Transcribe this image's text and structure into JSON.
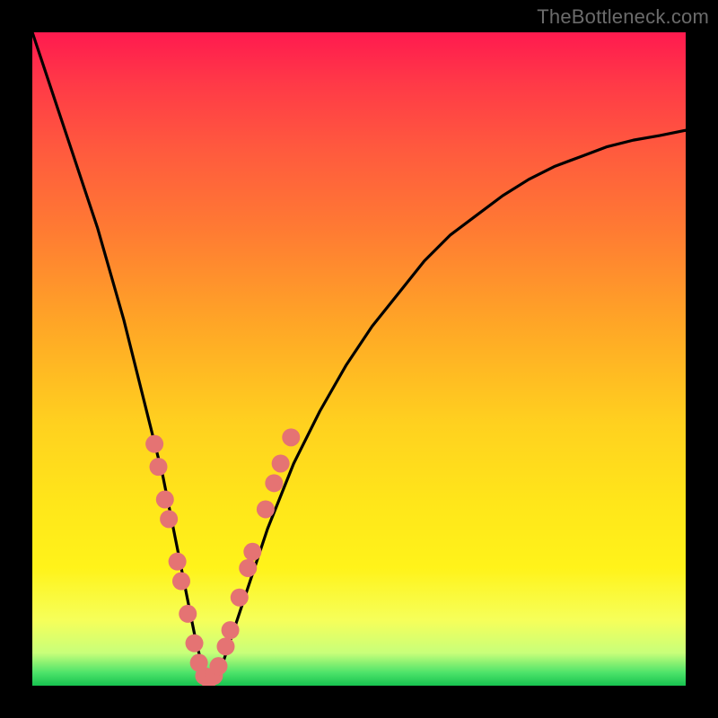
{
  "watermark": {
    "text": "TheBottleneck.com"
  },
  "chart_data": {
    "type": "line",
    "title": "",
    "xlabel": "",
    "ylabel": "",
    "xlim": [
      0,
      100
    ],
    "ylim": [
      0,
      100
    ],
    "series": [
      {
        "name": "bottleneck-curve",
        "x": [
          0,
          2,
          4,
          6,
          8,
          10,
          12,
          14,
          16,
          18,
          20,
          22,
          23,
          24,
          25,
          26,
          27,
          28,
          29,
          30,
          32,
          34,
          36,
          38,
          40,
          44,
          48,
          52,
          56,
          60,
          64,
          68,
          72,
          76,
          80,
          84,
          88,
          92,
          96,
          100
        ],
        "y": [
          100,
          94,
          88,
          82,
          76,
          70,
          63,
          56,
          48,
          40,
          32,
          22,
          17,
          12,
          7,
          3,
          1,
          1,
          3,
          6,
          12,
          18,
          24,
          29,
          34,
          42,
          49,
          55,
          60,
          65,
          69,
          72,
          75,
          77.5,
          79.5,
          81,
          82.5,
          83.5,
          84.2,
          85
        ]
      }
    ],
    "markers": {
      "name": "sample-points",
      "color": "#e57373",
      "radius": 10,
      "points": [
        {
          "x": 18.7,
          "y": 37.0
        },
        {
          "x": 19.3,
          "y": 33.5
        },
        {
          "x": 20.3,
          "y": 28.5
        },
        {
          "x": 20.9,
          "y": 25.5
        },
        {
          "x": 22.2,
          "y": 19.0
        },
        {
          "x": 22.8,
          "y": 16.0
        },
        {
          "x": 23.8,
          "y": 11.0
        },
        {
          "x": 24.8,
          "y": 6.5
        },
        {
          "x": 25.5,
          "y": 3.5
        },
        {
          "x": 26.3,
          "y": 1.5
        },
        {
          "x": 27.0,
          "y": 1.0
        },
        {
          "x": 27.8,
          "y": 1.5
        },
        {
          "x": 28.5,
          "y": 3.0
        },
        {
          "x": 29.6,
          "y": 6.0
        },
        {
          "x": 30.3,
          "y": 8.5
        },
        {
          "x": 31.7,
          "y": 13.5
        },
        {
          "x": 33.0,
          "y": 18.0
        },
        {
          "x": 33.7,
          "y": 20.5
        },
        {
          "x": 35.7,
          "y": 27.0
        },
        {
          "x": 37.0,
          "y": 31.0
        },
        {
          "x": 38.0,
          "y": 34.0
        },
        {
          "x": 39.6,
          "y": 38.0
        }
      ]
    }
  }
}
